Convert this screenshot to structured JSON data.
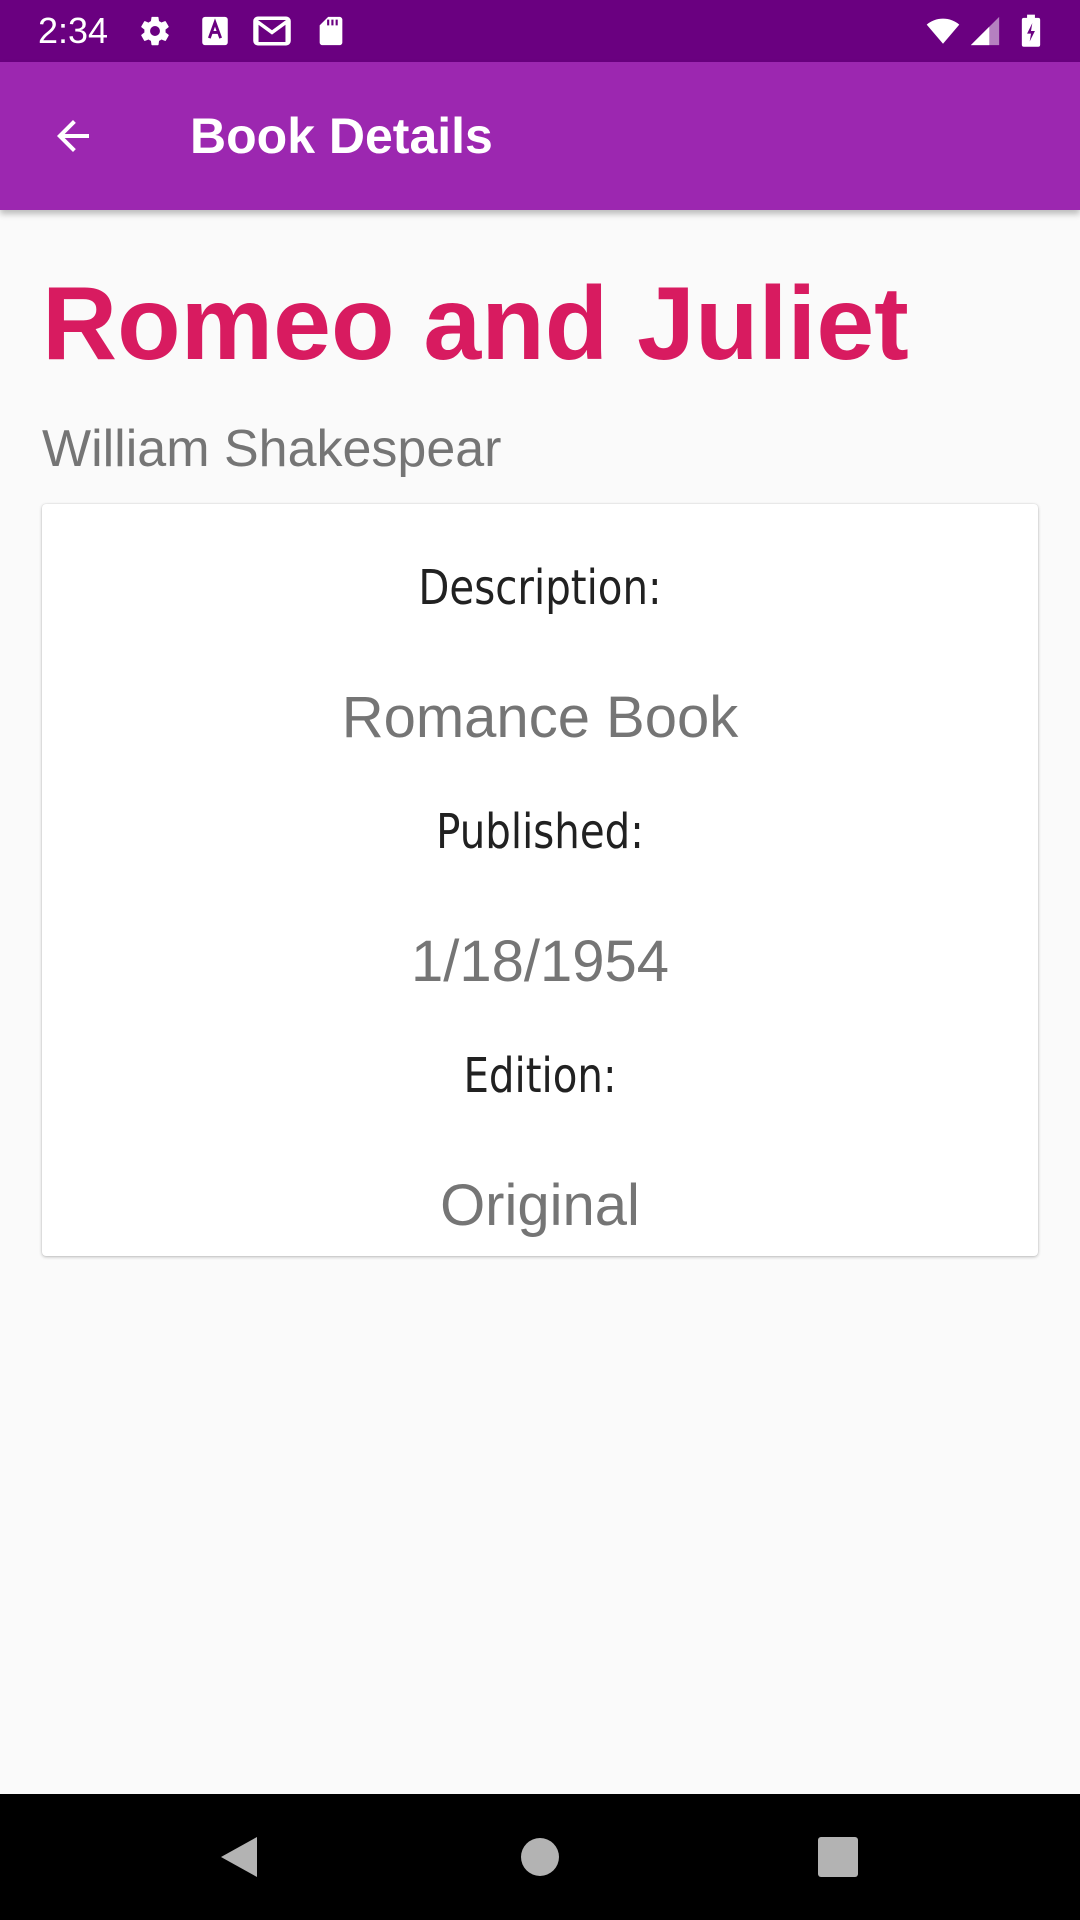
{
  "status_bar": {
    "time": "2:34",
    "icons_left": [
      "settings-icon",
      "font-a-icon",
      "gmail-icon",
      "sd-card-icon"
    ],
    "icons_right": [
      "wifi-icon",
      "signal-icon",
      "battery-charging-icon"
    ]
  },
  "app_bar": {
    "title": "Book Details",
    "back_icon": "arrow-back-icon",
    "background_color": "#9c27b0",
    "status_bar_color": "#6a0080"
  },
  "book": {
    "title": "Romeo and Juliet",
    "author": "William Shakespear",
    "title_color": "#d81b60"
  },
  "details": [
    {
      "label": "Description:",
      "value": "Romance Book"
    },
    {
      "label": "Published:",
      "value": "1/18/1954"
    },
    {
      "label": "Edition:",
      "value": "Original"
    }
  ],
  "nav_bar": {
    "buttons": [
      "back-triangle-icon",
      "home-circle-icon",
      "recents-square-icon"
    ]
  }
}
